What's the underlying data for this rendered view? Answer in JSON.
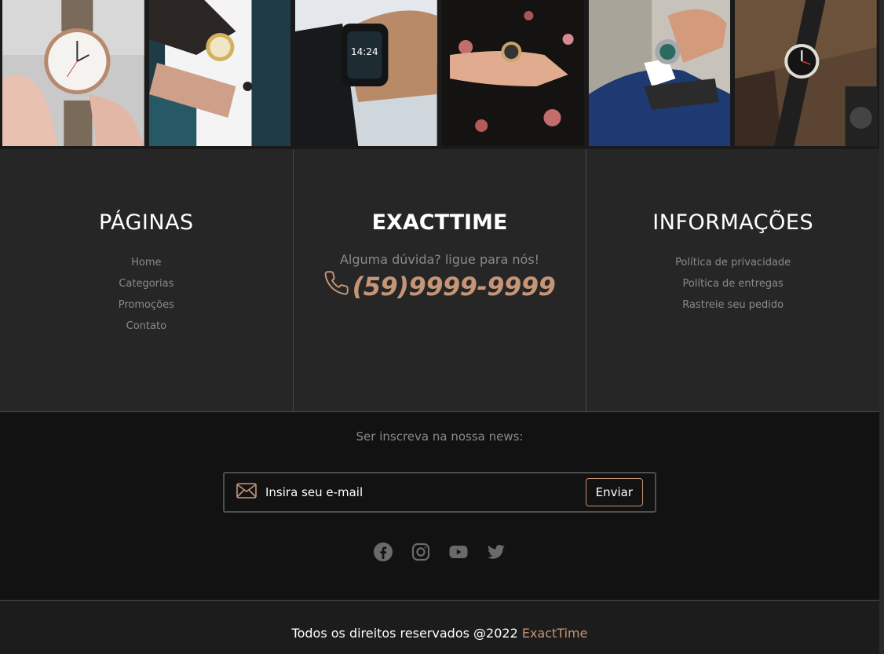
{
  "gallery": {
    "images": [
      {
        "alt": "watch-hand-photo"
      },
      {
        "alt": "gold-watch-suit-photo"
      },
      {
        "alt": "smartwatch-photo"
      },
      {
        "alt": "floral-dress-watch-photo"
      },
      {
        "alt": "blue-suit-watch-photo"
      },
      {
        "alt": "watch-on-sweater-photo"
      }
    ]
  },
  "pages": {
    "title": "PÁGINAS",
    "links": [
      "Home",
      "Categorias",
      "Promoções",
      "Contato"
    ]
  },
  "brand": {
    "title": "EXACTTIME",
    "ask": "Alguma dúvida? ligue para nós!",
    "phone": "(59)9999-9999"
  },
  "info": {
    "title": "INFORMAÇÕES",
    "links": [
      "Política de privacidade",
      "Política de entregas",
      "Rastreie seu pedido"
    ]
  },
  "newsletter": {
    "label": "Ser inscreva na nossa news:",
    "placeholder": "Insira seu e-mail",
    "button": "Enviar"
  },
  "social": [
    "facebook-icon",
    "instagram-icon",
    "youtube-icon",
    "twitter-icon"
  ],
  "footer": {
    "copyright": "Todos os direitos reservados @2022",
    "brand": "ExactTime"
  },
  "colors": {
    "accent": "#c69477",
    "muted_text": "#8a8a8a",
    "columns_bg": "#262626",
    "news_bg": "#121212"
  }
}
